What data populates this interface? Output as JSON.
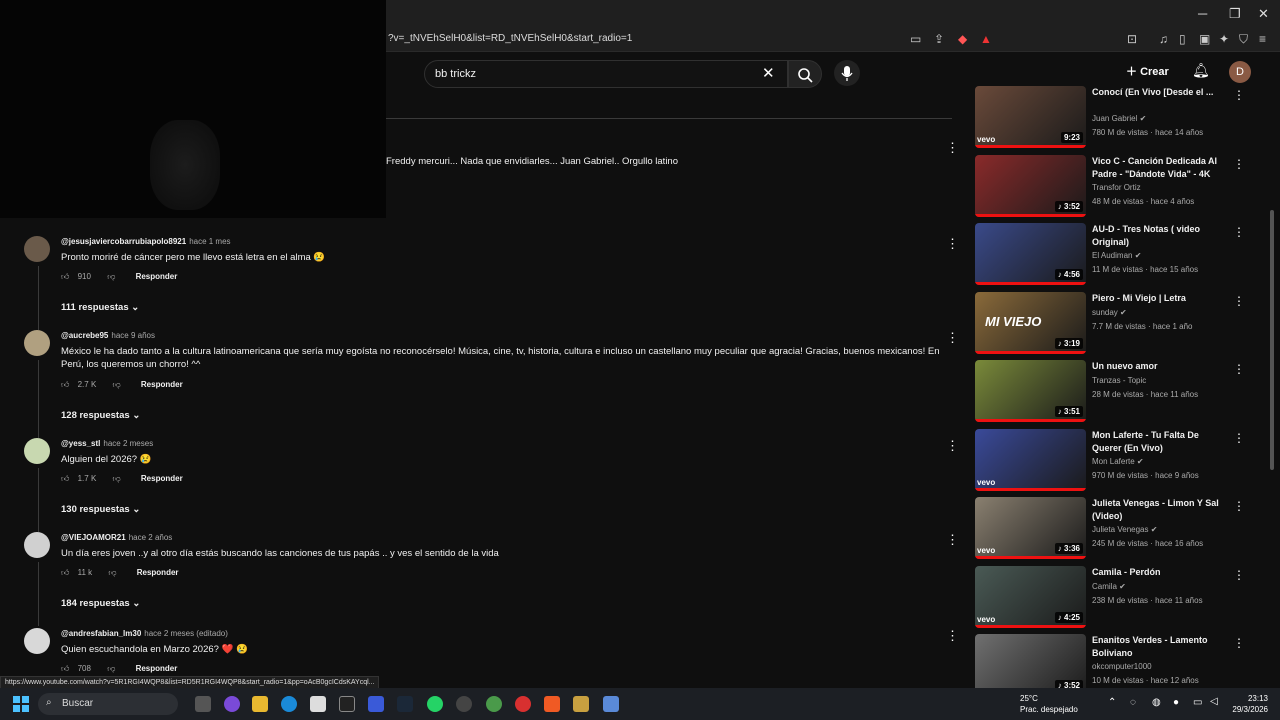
{
  "browser": {
    "url": "?v=_tNVEhSelH0&list=RD_tNVEhSelH0&start_radio=1",
    "status_url": "https://www.youtube.com/watch?v=5R1RGI4WQP8&list=RD5R1RGI4WQP8&start_radio=1&pp=oAcB0gcICdsKAYcql..."
  },
  "header": {
    "search_query": "bb trickz",
    "create_label": "Crear",
    "avatar_letter": "D"
  },
  "top_fragment": "Freddy mercuri... Nada que envidiarles... Juan Gabriel.. Orgullo latino",
  "comments": [
    {
      "user": "@jesusjaviercobarrubiapolo8921",
      "ago": "hace 1 mes",
      "text": "Pronto moriré de cáncer pero me llevo está letra en el alma 😢",
      "likes": "910",
      "reply": "Responder",
      "replies": "111 respuestas"
    },
    {
      "user": "@aucrebe95",
      "ago": "hace 9 años",
      "text": "México le ha dado tanto a la cultura latinoamericana que sería muy egoísta no reconocérselo! Música, cine, tv, historia, cultura e incluso un castellano muy peculiar que agracia! Gracias, buenos mexicanos! En Perú, los queremos un chorro! ^^",
      "likes": "2.7 K",
      "reply": "Responder",
      "replies": "128 respuestas"
    },
    {
      "user": "@yess_stl",
      "ago": "hace 2 meses",
      "text": "Alguien del 2026? 😢",
      "likes": "1.7 K",
      "reply": "Responder",
      "replies": "130 respuestas"
    },
    {
      "user": "@VIEJOAMOR21",
      "ago": "hace 2 años",
      "text": "Un día eres joven ..y al otro día estás buscando las canciones de tus papás ..  y ves el sentido de la vida",
      "likes": "11 k",
      "reply": "Responder",
      "replies": "184 respuestas"
    },
    {
      "user": "@andresfabian_lm30",
      "ago": "hace 2 meses (editado)",
      "text": "Quien escuchandola en Marzo 2026? ❤️ 😢",
      "likes": "708",
      "reply": "Responder",
      "replies": ""
    }
  ],
  "sidebar": [
    {
      "title": "Conocí (En Vivo [Desde el ...",
      "channel": "Juan Gabriel ✔",
      "meta": "780 M de vistas · hace 14 años",
      "duration": "9:23",
      "vevo": "vevo",
      "color": "#6a4a3a"
    },
    {
      "title": "Vico C - Canción Dedicada Al Padre - \"Dándote Vida\" - 4K",
      "channel": "Transfor Ortiz",
      "meta": "48 M de vistas · hace 4 años",
      "duration": "♪ 3:52",
      "vevo": "",
      "color": "#8a2a2a"
    },
    {
      "title": "AU-D  - Tres Notas ( video Original)",
      "channel": "El Audiman ✔",
      "meta": "11 M de vistas · hace 15 años",
      "duration": "♪ 4:56",
      "vevo": "",
      "color": "#3a4a8a"
    },
    {
      "title": "Piero - Mi Viejo | Letra",
      "channel": "sunday ✔",
      "meta": "7.7 M de vistas · hace 1 año",
      "duration": "♪ 3:19",
      "vevo": "",
      "color": "#8a6a3a",
      "thumb_text": "MI VIEJO"
    },
    {
      "title": "Un nuevo amor",
      "channel": "Tranzas - Topic",
      "meta": "28 M de vistas · hace 11 años",
      "duration": "♪ 3:51",
      "vevo": "",
      "color": "#7a8a3a"
    },
    {
      "title": "Mon Laferte - Tu Falta De Querer (En Vivo)",
      "channel": "Mon Laferte ✔",
      "meta": "970 M de vistas · hace 9 años",
      "duration": "",
      "vevo": "vevo",
      "color": "#3a4a9a"
    },
    {
      "title": "Julieta Venegas - Limon Y Sal (Video)",
      "channel": "Julieta Venegas ✔",
      "meta": "245 M de vistas · hace 16 años",
      "duration": "♪ 3:36",
      "vevo": "vevo",
      "color": "#8a8070"
    },
    {
      "title": "Camila - Perdón",
      "channel": "Camila ✔",
      "meta": "238 M de vistas · hace 11 años",
      "duration": "♪ 4:25",
      "vevo": "vevo",
      "color": "#4a5a55"
    },
    {
      "title": "Enanitos Verdes - Lamento Boliviano",
      "channel": "okcomputer1000",
      "meta": "10 M de vistas · hace 12 años",
      "duration": "♪ 3:52",
      "vevo": "",
      "color": "#707070"
    }
  ],
  "taskbar": {
    "search": "Buscar",
    "weather_temp": "25°C",
    "weather_desc": "Prac. despejado",
    "time": "23:13",
    "date": "29/3/2026"
  }
}
